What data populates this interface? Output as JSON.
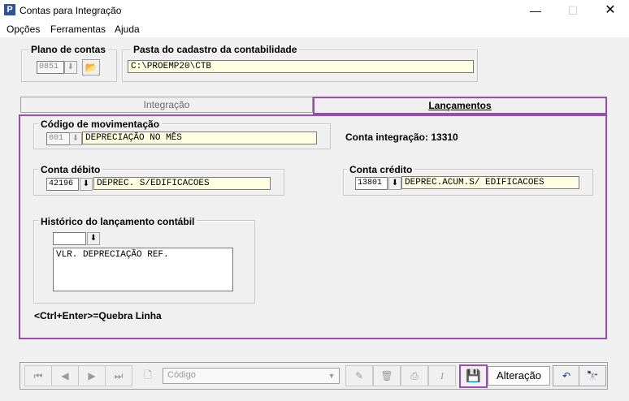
{
  "window": {
    "title": "Contas para Integração",
    "app_icon": "P"
  },
  "menu": [
    {
      "label": "Opções"
    },
    {
      "label": "Ferramentas"
    },
    {
      "label": "Ajuda"
    }
  ],
  "plano": {
    "label": "Plano de contas",
    "value": "0851"
  },
  "pasta": {
    "label": "Pasta do cadastro da contabilidade",
    "value": "C:\\PROEMP20\\CTB"
  },
  "tabs": [
    {
      "label": "Integração"
    },
    {
      "label": "Lançamentos"
    }
  ],
  "codigo_mov": {
    "label": "Código de movimentação",
    "code": "001",
    "desc": "DEPRECIAÇÃO NO MÊS"
  },
  "conta_integracao": "Conta integração: 13310",
  "debito": {
    "label": "Conta débito",
    "code": "42196",
    "desc": "DEPREC. S/EDIFICACOES"
  },
  "credito": {
    "label": "Conta crédito",
    "code": "13801",
    "desc": "DEPREC.ACUM.S/ EDIFICACOES"
  },
  "historico": {
    "label": "Histórico do lançamento contábil",
    "code": "",
    "text": "VLR. DEPRECIAÇÃO REF."
  },
  "hint": "<Ctrl+Enter>=Quebra Linha",
  "toolbar": {
    "search_placeholder": "Código",
    "mode": "Alteração"
  },
  "colors": {
    "accent": "#9b4bb3",
    "field_bg": "#ffffe1"
  }
}
